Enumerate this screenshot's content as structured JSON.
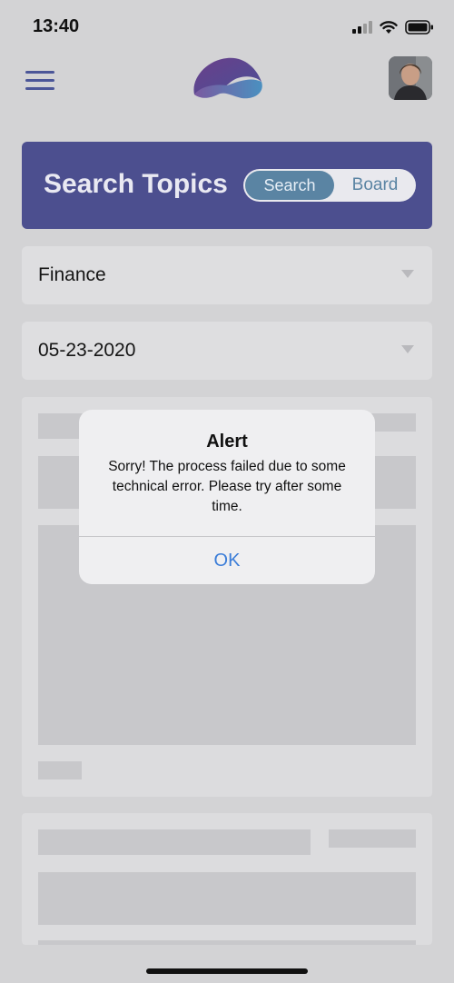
{
  "status_bar": {
    "time": "13:40",
    "icons": [
      "signal-icon",
      "wifi-icon",
      "battery-icon"
    ]
  },
  "header": {
    "menu_icon": "hamburger-menu-icon",
    "logo": "app-logo",
    "avatar": "user-avatar"
  },
  "banner": {
    "title": "Search Topics",
    "toggle": {
      "options": [
        "Search",
        "Board"
      ],
      "selected": "Search"
    }
  },
  "filters": {
    "category": {
      "value": "Finance"
    },
    "date": {
      "value": "05-23-2020"
    }
  },
  "alert": {
    "title": "Alert",
    "message": "Sorry! The process failed due to some technical error. Please try after some time.",
    "ok_label": "OK"
  },
  "colors": {
    "banner_bg": "#4c4f8f",
    "toggle_active": "#5a84a3",
    "alert_button": "#3b7dd8"
  }
}
